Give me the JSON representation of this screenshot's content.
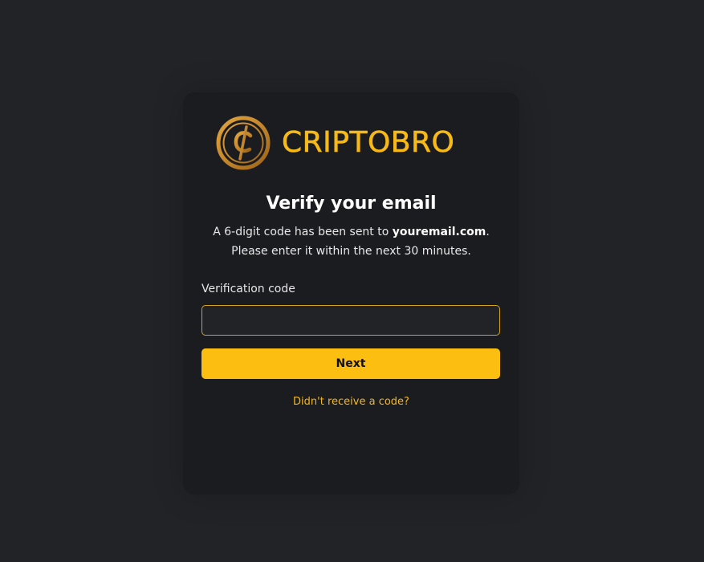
{
  "brand": {
    "name": "CRIPTOBRO",
    "logo_icon": "cent-coin-icon",
    "accent_color": "#fcbe10"
  },
  "verify": {
    "title": "Verify your email",
    "desc_prefix": "A 6-digit code has been sent to ",
    "email": "youremail.com",
    "desc_suffix": ".",
    "desc_line2": "Please enter it within the next 30 minutes."
  },
  "form": {
    "code_label": "Verification code",
    "code_value": "",
    "code_placeholder": "",
    "next_label": "Next"
  },
  "resend": {
    "label": "Didn't receive a code?"
  }
}
